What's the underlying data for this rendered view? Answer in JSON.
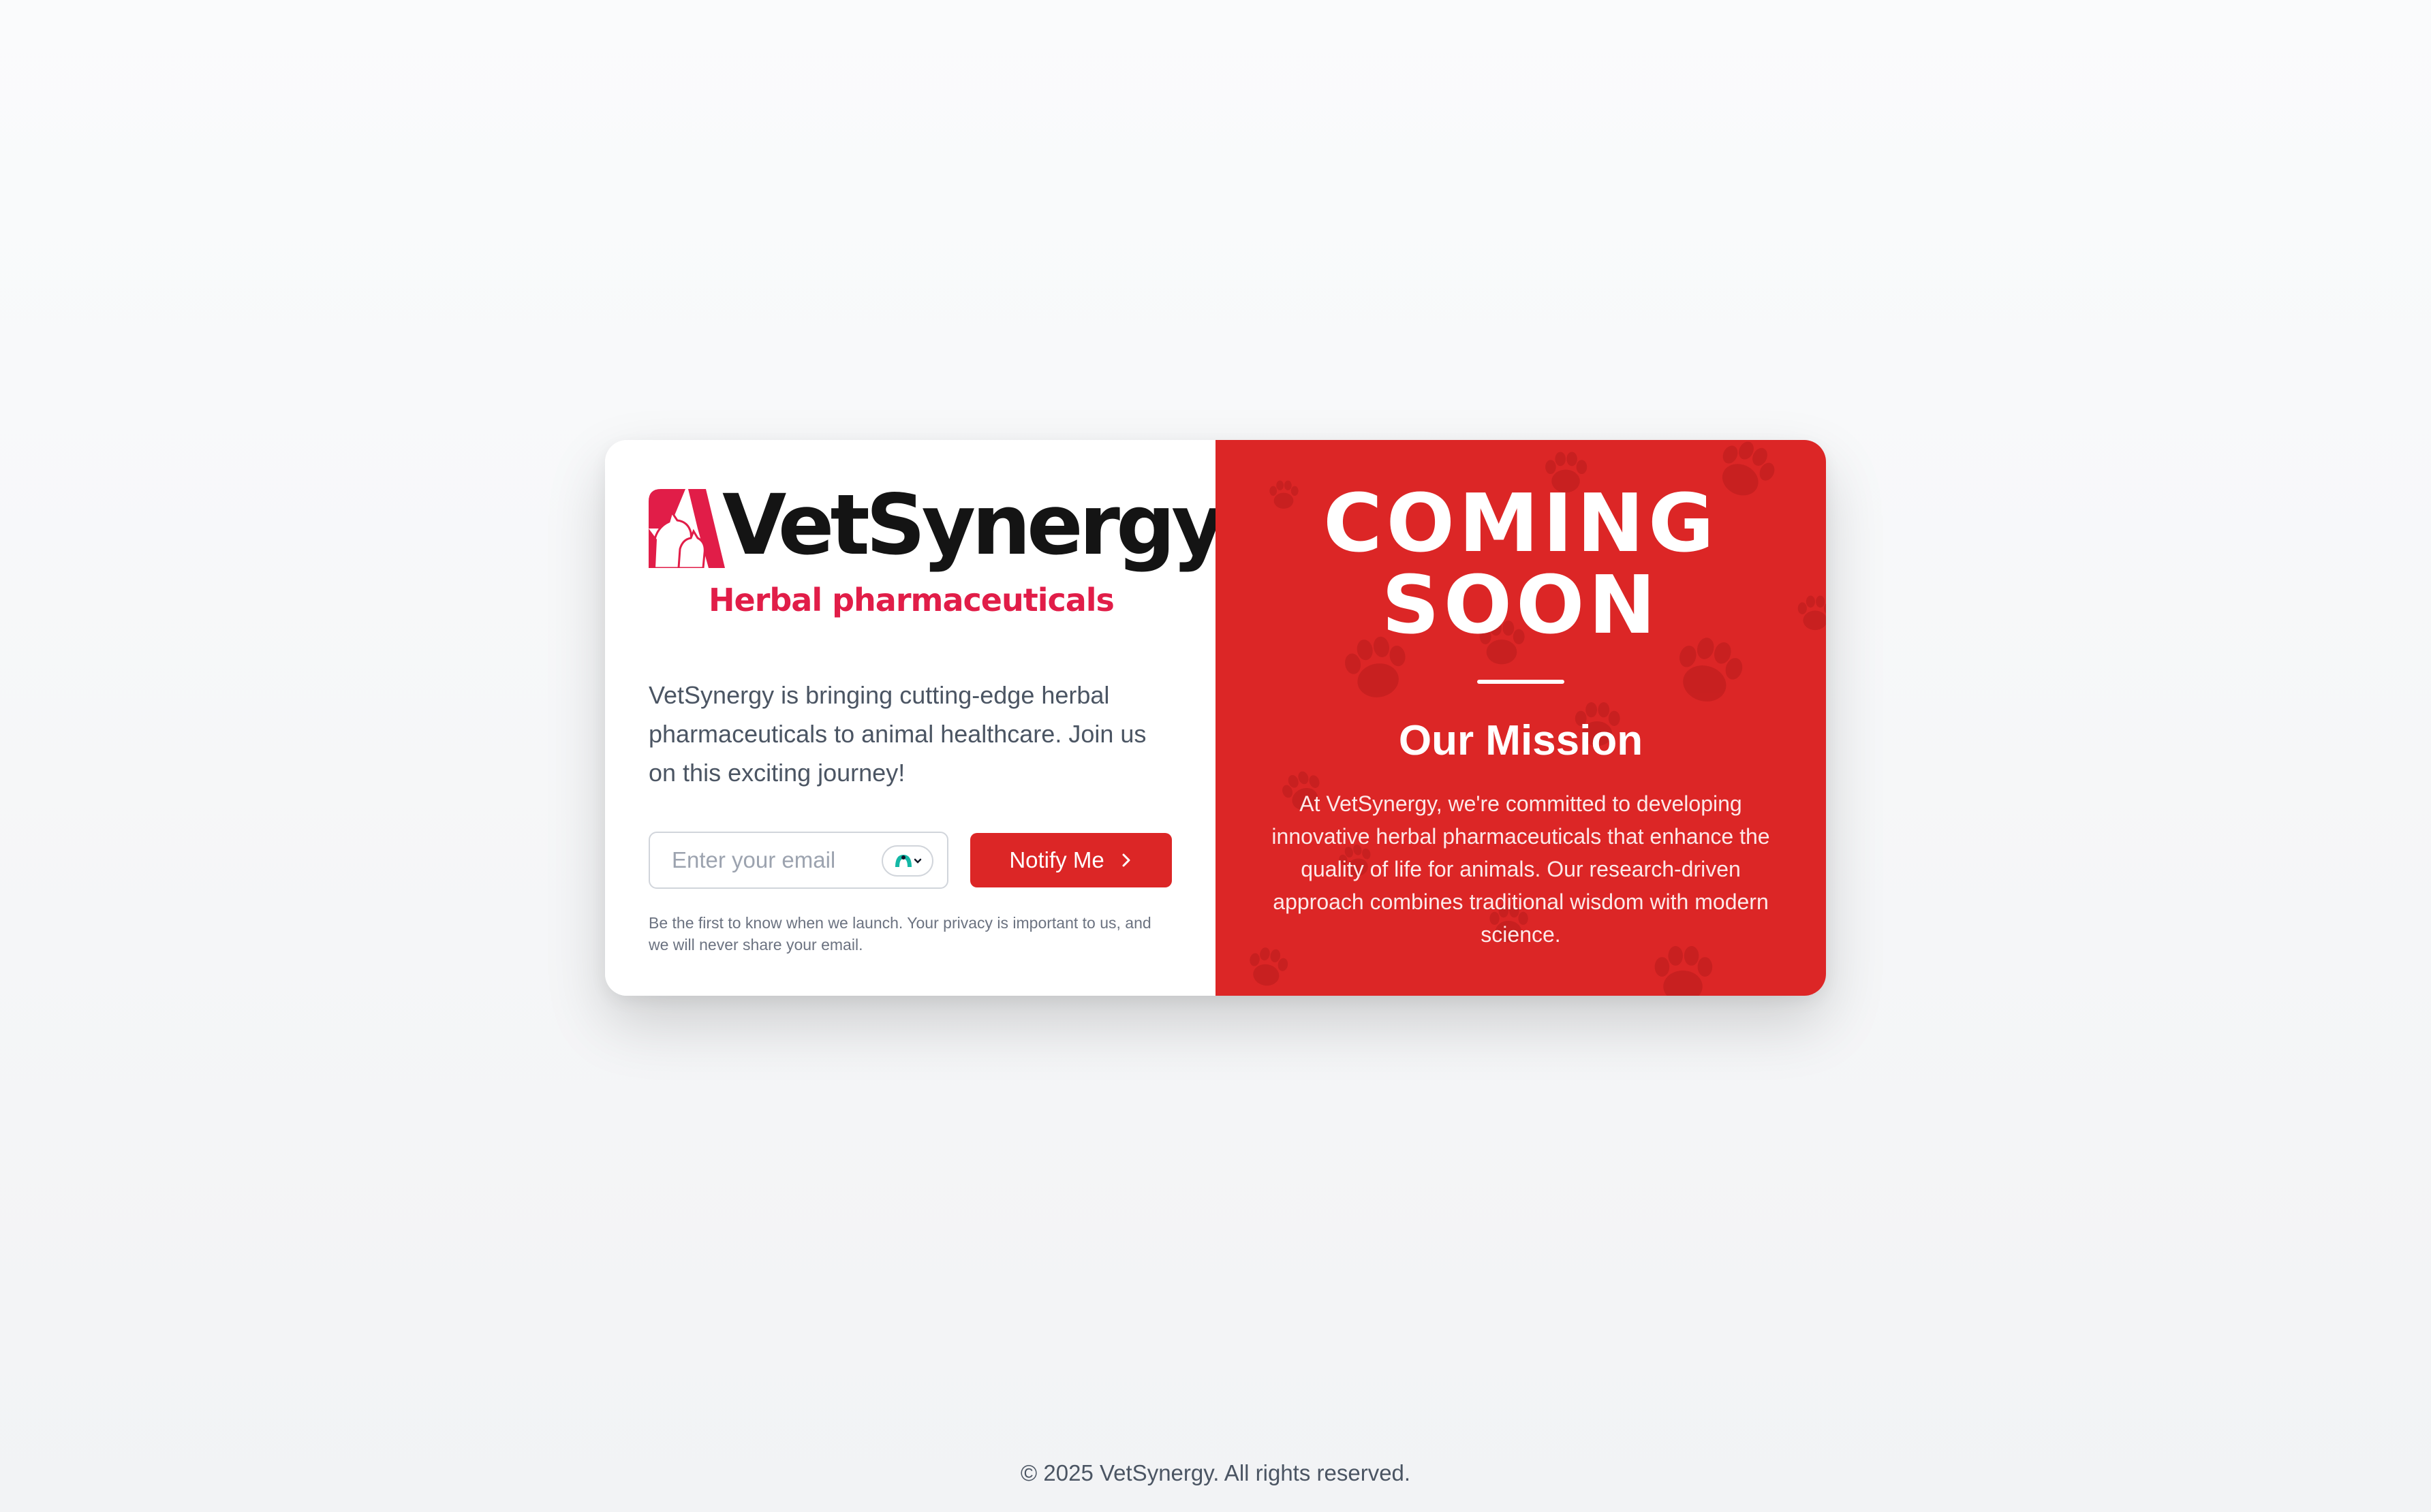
{
  "brand": {
    "name": "VetSynergy",
    "tagline": "Herbal pharmaceuticals",
    "logo_icon": "animal-silhouette-logo-icon"
  },
  "intro": {
    "text": "VetSynergy is bringing cutting-edge herbal pharmaceuticals to animal healthcare. Join us on this exciting journey!"
  },
  "signup": {
    "email_placeholder": "Enter your email",
    "email_value": "",
    "button_label": "Notify Me",
    "button_icon": "chevron-right-icon",
    "extension_icon": "password-manager-icon",
    "privacy_note": "Be the first to know when we launch. Your privacy is important to us, and we will never share your email."
  },
  "hero": {
    "heading": "COMING SOON",
    "mission_title": "Our Mission",
    "mission_text": "At VetSynergy, we're committed to developing innovative herbal pharmaceuticals that enhance the quality of life for animals. Our research-driven approach combines traditional wisdom with modern science.",
    "background_icon": "paw-print-icon"
  },
  "footer": {
    "copyright": "© 2025 VetSynergy. All rights reserved."
  },
  "colors": {
    "accent_red": "#dc2626",
    "brand_pink": "#e11d48",
    "text_gray": "#4b5563",
    "page_bg": "#f5f6f8"
  }
}
